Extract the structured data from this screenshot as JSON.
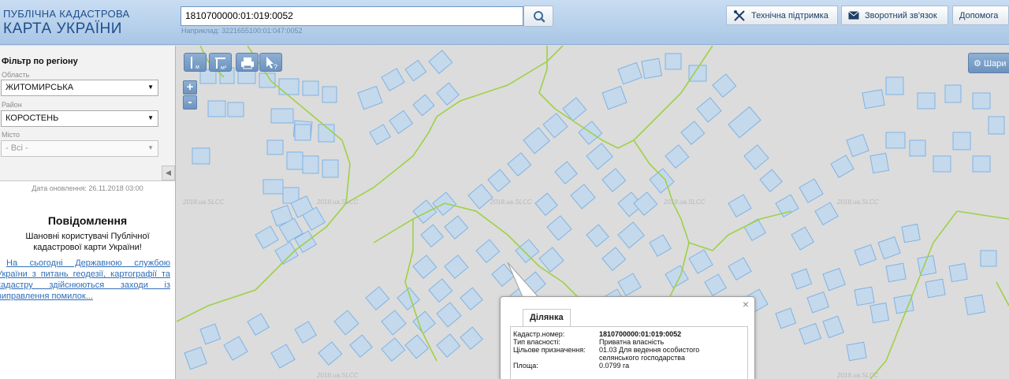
{
  "header": {
    "logo_line1": "ПУБЛІЧНА КАДАСТРОВА",
    "logo_line2": "КАРТА УКРАЇНИ",
    "search_value": "1810700000:01:019:0052",
    "search_hint": "Наприклад: 3221655100:01:047:0052",
    "search_icon": "search-icon",
    "buttons": [
      {
        "label": "Технічна підтримка",
        "icon": "tools-icon"
      },
      {
        "label": "Зворотний зв'язок",
        "icon": "envelope-icon"
      },
      {
        "label": "Допомога"
      }
    ]
  },
  "filter": {
    "title": "Фільтр по регіону",
    "oblast_label": "Область",
    "oblast_value": "ЖИТОМИРСЬКА",
    "raion_label": "Район",
    "raion_value": "КОРОСТЕНЬ",
    "misto_label": "Місто",
    "misto_value": "- Всі -",
    "collapse_icon": "◀"
  },
  "updated": "Дата оновлення: 26.11.2018 03:00",
  "message": {
    "title": "Повідомлення",
    "body": "Шановні користувачі Публічної кадастрової карти України!",
    "link": "На сьогодні Державною службою України з питань геодезії, картографії та кадастру здійснюються заходи із виправлення помилок..."
  },
  "map": {
    "tools": [
      {
        "label": "I м",
        "icon": "measure-length-icon"
      },
      {
        "label": "м²",
        "icon": "measure-area-icon"
      },
      {
        "label": "",
        "icon": "print-icon"
      },
      {
        "label": "?",
        "icon": "identify-icon"
      }
    ],
    "zoom_in": "+",
    "zoom_out": "-",
    "layers_label": "Шари",
    "watermark": "2018.ua.SLCC"
  },
  "popup": {
    "tab": "Ділянка",
    "close": "×",
    "rows": [
      {
        "label": "Кадастр.номер:",
        "value": "1810700000:01:019:0052"
      },
      {
        "label": "Тип власності:",
        "value": "Приватна власність"
      },
      {
        "label": "Цільове призначення:",
        "value": "01.03 Для ведення особистого селянського господарства"
      },
      {
        "label": "Площа:",
        "value": "0.0799 га"
      }
    ]
  },
  "colors": {
    "parcel_fill": "#c5d9ec",
    "parcel_stroke": "#7fb3e3",
    "boundary": "#9ed145",
    "toolbar": "#7fa2c8"
  }
}
